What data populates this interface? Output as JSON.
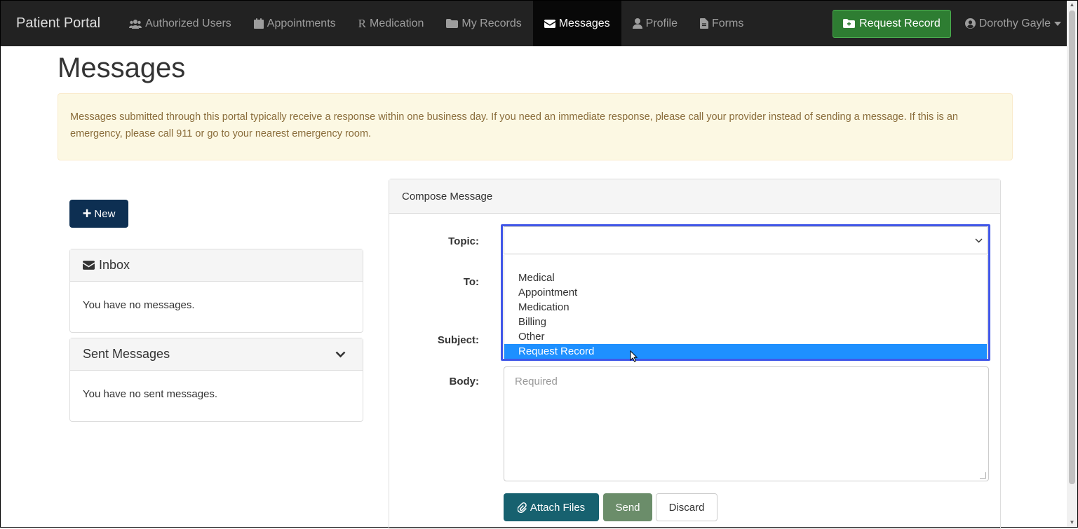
{
  "navbar": {
    "brand": "Patient Portal",
    "items": [
      {
        "label": "Authorized Users",
        "icon": "users-icon"
      },
      {
        "label": "Appointments",
        "icon": "calendar-icon"
      },
      {
        "label": "Medication",
        "icon": "rx-icon"
      },
      {
        "label": "My Records",
        "icon": "folder-icon"
      },
      {
        "label": "Messages",
        "icon": "envelope-icon",
        "active": true
      },
      {
        "label": "Profile",
        "icon": "user-icon"
      },
      {
        "label": "Forms",
        "icon": "file-icon"
      }
    ],
    "rx_glyph": "R",
    "request_record_label": "Request Record",
    "user_name": "Dorothy Gayle"
  },
  "page": {
    "title": "Messages",
    "alert_text": "Messages submitted through this portal typically receive a response within one business day. If you need an immediate response, please call your provider instead of sending a message. If this is an emergency, please call 911 or go to your nearest emergency room."
  },
  "sidebar": {
    "new_label": "New",
    "inbox_title": "Inbox",
    "inbox_empty": "You have no messages.",
    "sent_title": "Sent Messages",
    "sent_empty": "You have no sent messages."
  },
  "compose": {
    "heading": "Compose Message",
    "topic_label": "Topic:",
    "to_label": "To:",
    "subject_label": "Subject:",
    "body_label": "Body:",
    "topic_value": "",
    "topic_options": [
      "Medical",
      "Appointment",
      "Medication",
      "Billing",
      "Other",
      "Request Record"
    ],
    "highlighted_option": "Request Record",
    "body_placeholder": "Required",
    "attach_label": "Attach Files",
    "send_label": "Send",
    "discard_label": "Discard"
  },
  "colors": {
    "navbar_bg": "#222222",
    "request_btn": "#2e7d32",
    "alert_bg": "#fcf8e3",
    "new_btn": "#0d2f52",
    "highlight": "#1e90ff",
    "focus_ring": "#4157e8",
    "attach_btn": "#17616f",
    "send_btn": "#6b8d6a"
  }
}
